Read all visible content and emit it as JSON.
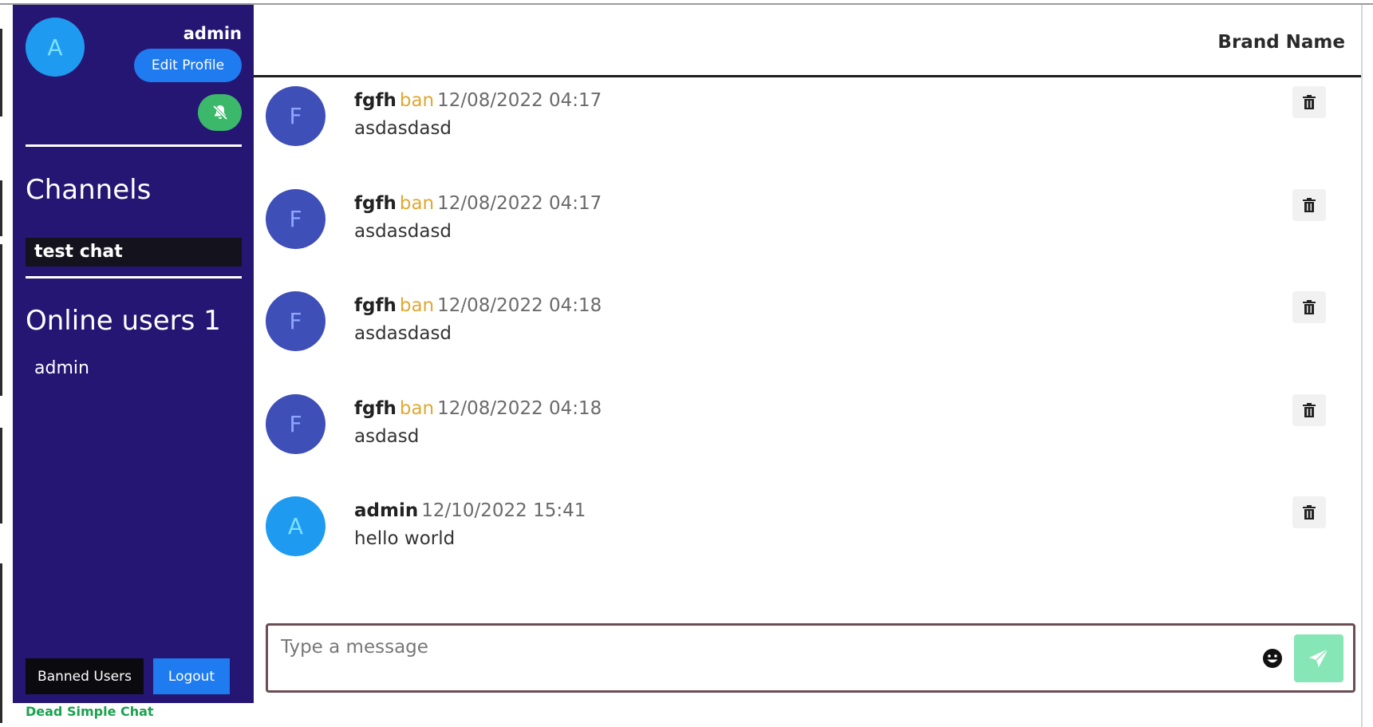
{
  "sidebar": {
    "me": {
      "initial": "A",
      "name": "admin"
    },
    "edit_profile_label": "Edit Profile",
    "channels_title": "Channels",
    "channels": [
      {
        "label": "test chat"
      }
    ],
    "online_title": "Online users 1",
    "online_users": [
      {
        "name": "admin"
      }
    ],
    "banned_users_label": "Banned Users",
    "logout_label": "Logout",
    "footer": "Dead Simple Chat"
  },
  "header": {
    "brand": "Brand Name"
  },
  "messages": [
    {
      "initial": "F",
      "user": "fgfh",
      "ban": "ban",
      "time": "12/08/2022 04:17",
      "text": "asdasdasd"
    },
    {
      "initial": "F",
      "user": "fgfh",
      "ban": "ban",
      "time": "12/08/2022 04:17",
      "text": "asdasdasd"
    },
    {
      "initial": "F",
      "user": "fgfh",
      "ban": "ban",
      "time": "12/08/2022 04:18",
      "text": "asdasdasd"
    },
    {
      "initial": "F",
      "user": "fgfh",
      "ban": "ban",
      "time": "12/08/2022 04:18",
      "text": "asdasd"
    },
    {
      "initial": "A",
      "user": "admin",
      "time": "12/10/2022 15:41",
      "text": "hello world"
    }
  ],
  "composer": {
    "placeholder": "Type a message",
    "value": ""
  },
  "icons": {
    "notifications": "bell-slash-icon",
    "delete": "trash-icon",
    "emoji": "smile-emoji-icon",
    "send": "paper-plane-icon"
  },
  "colors": {
    "sidebar": "#261673",
    "primary_button": "#1f7bf0",
    "ban": "#e0a830",
    "avatar_f": "#3f4fb8",
    "avatar_a": "#1e9bf0",
    "send": "#86e6b5",
    "footer": "#1aa24f"
  }
}
